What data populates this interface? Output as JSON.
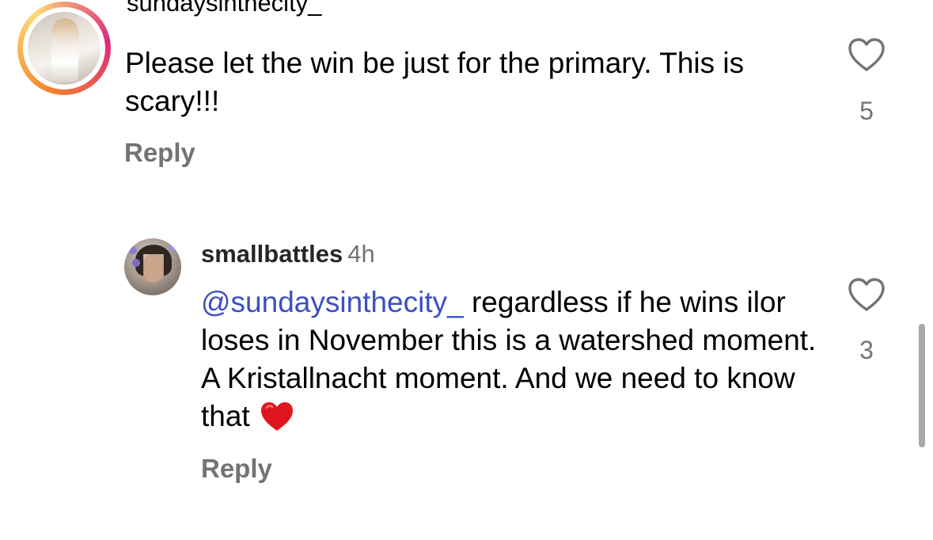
{
  "comments": [
    {
      "username": "sundaysinthecity_",
      "text": "Please let the win be just for the primary. This is scary!!!",
      "reply_label": "Reply",
      "like_count": "5"
    }
  ],
  "replies": [
    {
      "username": "smallbattles",
      "time": "4h",
      "mention": "@sundaysinthecity_",
      "text": " regardless if he wins ilor loses in November this is a watershed moment. A Kristallnacht moment. And we need to know that",
      "emoji": "red-heart-emoji",
      "reply_label": "Reply",
      "like_count": "3"
    }
  ],
  "colors": {
    "mention": "#3d4fbf",
    "secondary_text": "#737373",
    "story_ring": [
      "#f58529",
      "#feda77",
      "#dd2a7b"
    ]
  },
  "icons": {
    "like": "heart-outline-icon",
    "emoji": "red-heart-emoji"
  }
}
